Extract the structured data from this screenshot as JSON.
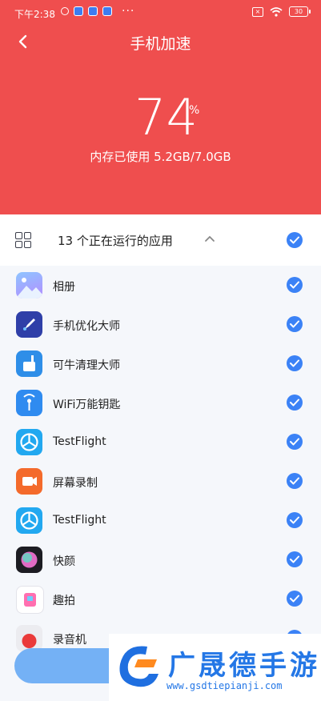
{
  "status": {
    "time": "下午2:38",
    "dots": "···",
    "battery": "30"
  },
  "header": {
    "title": "手机加速"
  },
  "memory": {
    "percent": "74",
    "percent_sign": "%",
    "usage_text": "内存已使用 5.2GB/7.0GB"
  },
  "running": {
    "label": "13 个正在运行的应用",
    "all_selected": true
  },
  "apps": [
    {
      "name": "相册",
      "icon": "gallery-icon",
      "checked": true
    },
    {
      "name": "手机优化大师",
      "icon": "rocket-icon",
      "checked": true
    },
    {
      "name": "可牛清理大师",
      "icon": "broom-icon",
      "checked": true
    },
    {
      "name": "WiFi万能钥匙",
      "icon": "wifi-key-icon",
      "checked": true
    },
    {
      "name": "TestFlight",
      "icon": "testflight-icon",
      "checked": true
    },
    {
      "name": "屏幕录制",
      "icon": "screen-record-icon",
      "checked": true
    },
    {
      "name": "TestFlight",
      "icon": "testflight-icon",
      "checked": true
    },
    {
      "name": "快颜",
      "icon": "kuaiyan-icon",
      "checked": true
    },
    {
      "name": "趣拍",
      "icon": "qupai-icon",
      "checked": true
    },
    {
      "name": "录音机",
      "icon": "recorder-icon",
      "checked": true
    }
  ],
  "watermark": {
    "brand": "广晟德手游",
    "url": "www.gsdtiepianji.com"
  },
  "colors": {
    "hero": "#ef4e4e",
    "accent": "#3b82f6",
    "button": "#74b1f5"
  }
}
